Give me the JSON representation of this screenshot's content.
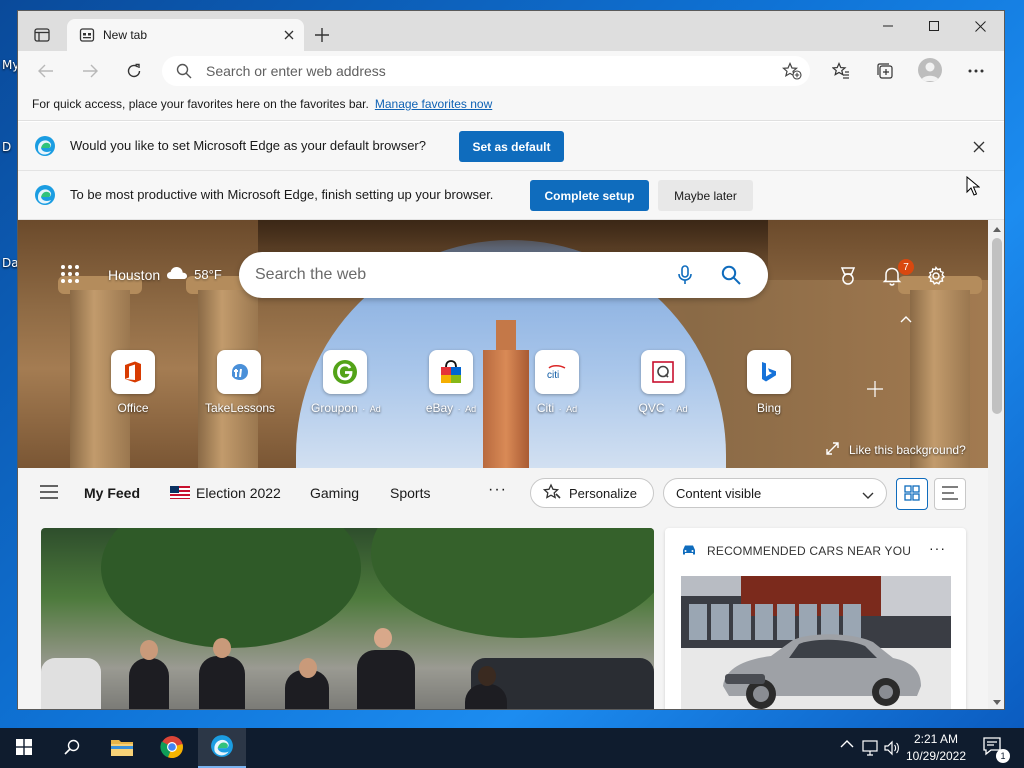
{
  "desktop": {
    "icon_labels": [
      "My",
      "D",
      "Da"
    ]
  },
  "browser": {
    "tab": {
      "title": "New tab"
    },
    "address_bar": {
      "placeholder": "Search or enter web address",
      "value": ""
    },
    "favorites_bar": {
      "text": "For quick access, place your favorites here on the favorites bar.",
      "link": "Manage favorites now"
    },
    "default_infobar": {
      "text": "Would you like to set Microsoft Edge as your default browser?",
      "button": "Set as default"
    },
    "setup_infobar": {
      "text": "To be most productive with Microsoft Edge, finish setting up your browser.",
      "primary_button": "Complete setup",
      "secondary_button": "Maybe later"
    }
  },
  "newtab": {
    "weather": {
      "city": "Houston",
      "temp": "58°F"
    },
    "search": {
      "placeholder": "Search the web"
    },
    "notification_count": "7",
    "tiles": [
      {
        "label": "Office",
        "ad": ""
      },
      {
        "label": "TakeLessons",
        "ad": ""
      },
      {
        "label": "Groupon",
        "ad": "Ad"
      },
      {
        "label": "eBay",
        "ad": "Ad"
      },
      {
        "label": "Citi",
        "ad": "Ad"
      },
      {
        "label": "QVC",
        "ad": "Ad"
      },
      {
        "label": "Bing",
        "ad": ""
      }
    ],
    "like_background": "Like this background?",
    "feed_nav": {
      "my_feed": "My Feed",
      "election": "Election 2022",
      "gaming": "Gaming",
      "sports": "Sports",
      "more": "···",
      "personalize": "Personalize",
      "content_visible": "Content visible"
    },
    "side_card": {
      "title": "RECOMMENDED CARS NEAR YOU",
      "more": "···"
    }
  },
  "taskbar": {
    "time": "2:21 AM",
    "date": "10/29/2022",
    "notification_count": "1"
  },
  "colors": {
    "accent": "#0f6cbd",
    "badge": "#d9480f",
    "taskbar": "#0f1c2e"
  }
}
